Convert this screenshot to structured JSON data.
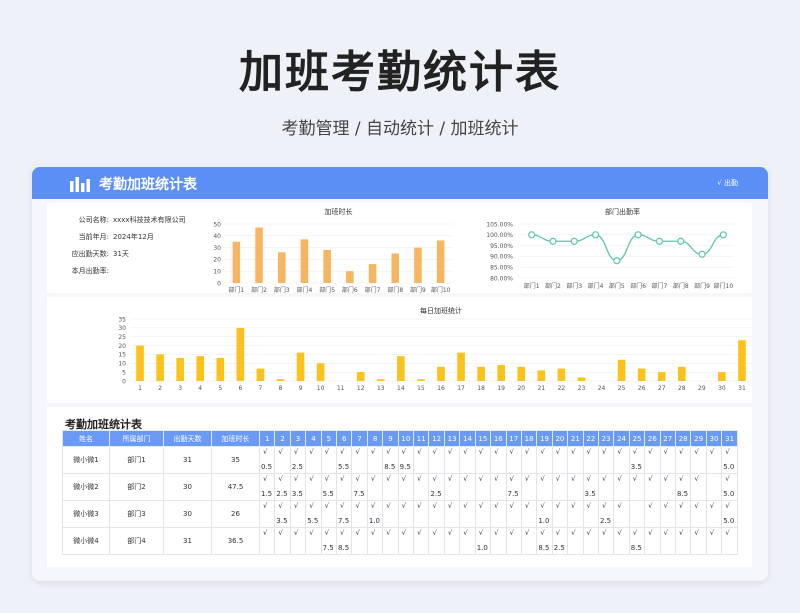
{
  "page": {
    "title": "加班考勤统计表",
    "subtitle": "考勤管理 / 自动统计 / 加班统计"
  },
  "card": {
    "title": "考勤加班统计表",
    "right_label": "√ 出勤"
  },
  "info": [
    {
      "label": "公司名称:",
      "value": "xxxx科技技术有限公司"
    },
    {
      "label": "当前年月:",
      "value": "2024年12月"
    },
    {
      "label": "应出勤天数:",
      "value": "31天"
    },
    {
      "label": "本月出勤率:",
      "value": ""
    }
  ],
  "charts": {
    "overtime": {
      "type": "bar",
      "title": "加班时长",
      "categories": [
        "部门1",
        "部门2",
        "部门3",
        "部门4",
        "部门5",
        "部门6",
        "部门7",
        "部门8",
        "部门9",
        "部门10"
      ],
      "values": [
        35,
        47,
        26,
        37,
        28,
        10,
        16,
        25,
        30,
        36
      ],
      "ylim": [
        0,
        50
      ],
      "yticks": [
        0,
        10,
        20,
        30,
        40,
        50
      ],
      "color": "#f7b461"
    },
    "attendance": {
      "type": "line",
      "title": "部门出勤率",
      "categories": [
        "部门1",
        "部门2",
        "部门3",
        "部门4",
        "部门5",
        "部门6",
        "部门7",
        "部门8",
        "部门9",
        "部门10"
      ],
      "values": [
        100,
        97,
        97,
        100,
        88,
        100,
        97,
        97,
        91,
        100
      ],
      "ylim": [
        80,
        105
      ],
      "yticks": [
        "80.00%",
        "85.00%",
        "90.00%",
        "95.00%",
        "100.00%",
        "105.00%"
      ],
      "color": "#5cc9a0"
    },
    "daily": {
      "type": "bar",
      "title": "每日加班统计",
      "categories": [
        "1",
        "2",
        "3",
        "4",
        "5",
        "6",
        "7",
        "8",
        "9",
        "10",
        "11",
        "12",
        "13",
        "14",
        "15",
        "16",
        "17",
        "18",
        "19",
        "20",
        "21",
        "22",
        "23",
        "24",
        "25",
        "26",
        "27",
        "28",
        "29",
        "30",
        "31"
      ],
      "values": [
        20,
        15,
        13,
        14,
        13,
        30,
        7,
        1,
        16,
        10,
        0,
        5,
        1,
        14,
        1,
        8,
        16,
        8,
        9,
        8,
        6,
        7,
        2,
        0,
        12,
        7,
        5,
        8,
        0,
        5,
        23
      ],
      "ylim": [
        0,
        35
      ],
      "yticks": [
        0,
        5,
        10,
        15,
        20,
        25,
        30,
        35
      ],
      "color": "#fcc21b"
    }
  },
  "table": {
    "title": "考勤加班统计表",
    "headers": [
      "姓名",
      "所属部门",
      "出勤天数",
      "加班时长"
    ],
    "days": [
      "1",
      "2",
      "3",
      "4",
      "5",
      "6",
      "7",
      "8",
      "9",
      "10",
      "11",
      "12",
      "13",
      "14",
      "15",
      "16",
      "17",
      "18",
      "19",
      "20",
      "21",
      "22",
      "23",
      "24",
      "25",
      "26",
      "27",
      "28",
      "29",
      "30",
      "31"
    ],
    "rows": [
      {
        "name": "微小微1",
        "dept": "部门1",
        "days_present": "31",
        "overtime": "35",
        "checks": [
          "√",
          "√",
          "√",
          "√",
          "√",
          "√",
          "√",
          "√",
          "√",
          "√",
          "√",
          "√",
          "√",
          "√",
          "√",
          "√",
          "√",
          "√",
          "√",
          "√",
          "√",
          "√",
          "√",
          "√",
          "√",
          "√",
          "√",
          "√",
          "√",
          "√",
          "√"
        ],
        "hours": [
          "0.5",
          "",
          "2.5",
          "",
          "",
          "5.5",
          "",
          "",
          "8.5",
          "9.5",
          "",
          "",
          "",
          "",
          "",
          "",
          "",
          "",
          "",
          "",
          "",
          "",
          "",
          "",
          "3.5",
          "",
          "",
          "",
          "",
          "",
          "5.0"
        ]
      },
      {
        "name": "微小微2",
        "dept": "部门2",
        "days_present": "30",
        "overtime": "47.5",
        "checks": [
          "√",
          "√",
          "√",
          "√",
          "√",
          "√",
          "√",
          "√",
          "√",
          "√",
          "√",
          "√",
          "√",
          "√",
          "√",
          "√",
          "√",
          "√",
          "√",
          "√",
          "√",
          "√",
          "√",
          "√",
          "√",
          "√",
          "√",
          "√",
          "√",
          "",
          "√"
        ],
        "hours": [
          "1.5",
          "2.5",
          "3.5",
          "",
          "5.5",
          "",
          "7.5",
          "",
          "",
          "",
          "",
          "2.5",
          "",
          "",
          "",
          "",
          "7.5",
          "",
          "",
          "",
          "",
          "3.5",
          "",
          "",
          "",
          "",
          "",
          "8.5",
          "",
          "",
          "5.0"
        ]
      },
      {
        "name": "微小微3",
        "dept": "部门3",
        "days_present": "30",
        "overtime": "26",
        "checks": [
          "√",
          "√",
          "√",
          "√",
          "√",
          "√",
          "√",
          "√",
          "√",
          "√",
          "√",
          "√",
          "√",
          "√",
          "√",
          "√",
          "√",
          "√",
          "√",
          "√",
          "√",
          "√",
          "√",
          "√",
          "",
          "√",
          "√",
          "√",
          "√",
          "√",
          "√"
        ],
        "hours": [
          "",
          "3.5",
          "",
          "5.5",
          "",
          "7.5",
          "",
          "1.0",
          "",
          "",
          "",
          "",
          "",
          "",
          "",
          "",
          "",
          "",
          "1.0",
          "",
          "",
          "",
          "2.5",
          "",
          "",
          "",
          "",
          "",
          "",
          "",
          "5.0"
        ]
      },
      {
        "name": "微小微4",
        "dept": "部门4",
        "days_present": "31",
        "overtime": "36.5",
        "checks": [
          "√",
          "√",
          "√",
          "√",
          "√",
          "√",
          "√",
          "√",
          "√",
          "√",
          "√",
          "√",
          "√",
          "√",
          "√",
          "√",
          "√",
          "√",
          "√",
          "√",
          "√",
          "√",
          "√",
          "√",
          "√",
          "√",
          "√",
          "√",
          "√",
          "√",
          "√"
        ],
        "hours": [
          "",
          "",
          "",
          "",
          "7.5",
          "8.5",
          "",
          "",
          "",
          "",
          "",
          "",
          "",
          "",
          "1.0",
          "",
          "",
          "",
          "8.5",
          "2.5",
          "",
          "",
          "",
          "",
          "8.5",
          "",
          "",
          "",
          "",
          "",
          ""
        ]
      }
    ]
  }
}
